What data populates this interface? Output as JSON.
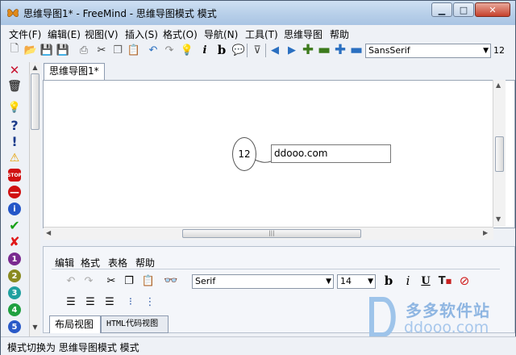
{
  "window": {
    "title": "思维导图1* - FreeMind - 思维导图模式 模式"
  },
  "menubar": [
    "文件(F)",
    "编辑(E)",
    "视图(V)",
    "插入(S)",
    "格式(O)",
    "导航(N)",
    "工具(T)",
    "思维导图",
    "帮助"
  ],
  "toolbar": {
    "font": "SansSerif",
    "size": "12"
  },
  "tab": {
    "label": "思维导图1*"
  },
  "map": {
    "root_node": "12",
    "child_node": "ddooo.com"
  },
  "editor": {
    "menu": [
      "编辑",
      "格式",
      "表格",
      "帮助"
    ],
    "font": "Serif",
    "size": "14",
    "bold_label": "b",
    "italic_label": "i",
    "underline_label": "U"
  },
  "bottom_tabs": [
    "布局视图",
    "HTML代码视图"
  ],
  "status": {
    "text": "模式切换为 思维导图模式 模式"
  },
  "watermark": {
    "title": "多多软件站",
    "url": "ddooo.com"
  },
  "left_icons": [
    "close-icon",
    "trash-icon",
    "lightbulb-icon",
    "question-icon",
    "exclamation-icon",
    "warning-icon",
    "stop-icon",
    "minus-circle-icon",
    "info-icon",
    "check-icon",
    "cross-icon",
    "priority-1-icon",
    "priority-2-icon",
    "priority-3-icon",
    "priority-4-icon",
    "priority-5-icon"
  ],
  "left_numbers": [
    "1",
    "2",
    "3",
    "4",
    "5"
  ]
}
